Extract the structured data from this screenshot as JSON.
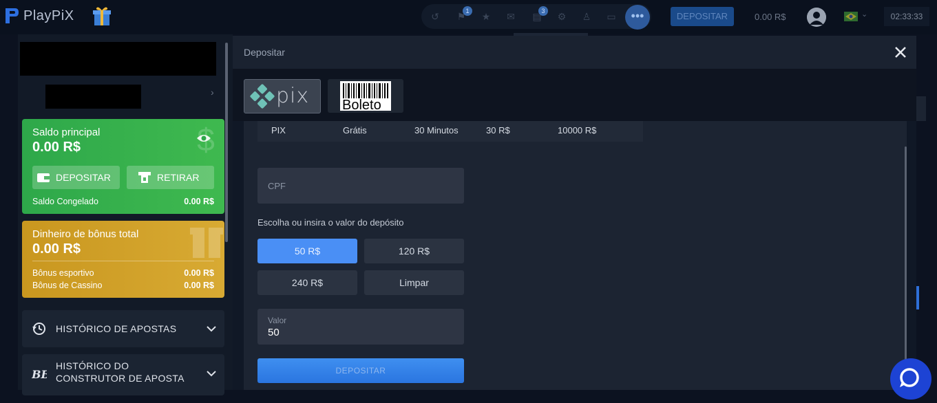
{
  "header": {
    "app_name": "PlayPiX",
    "deposit_button": "DEPOSITAR",
    "balance": "0.00 R$",
    "time": "02:33:33",
    "badge_messages": "1",
    "badge_notifications": "3",
    "more_icon": "•••"
  },
  "sidebar": {
    "main_balance": {
      "title": "Saldo principal",
      "amount": "0.00 R$",
      "deposit_label": "DEPOSITAR",
      "withdraw_label": "RETIRAR",
      "frozen_label": "Saldo Congelado",
      "frozen_value": "0.00 R$"
    },
    "bonus_balance": {
      "title": "Dinheiro de bônus total",
      "amount": "0.00 R$",
      "sport_label": "Bônus esportivo",
      "sport_value": "0.00 R$",
      "casino_label": "Bônus de Cassino",
      "casino_value": "0.00 R$"
    },
    "accordion": {
      "bet_history": "HISTÓRICO DE APOSTAS",
      "builder_history_line1": "HISTÓRICO DO",
      "builder_history_line2": "CONSTRUTOR DE APOSTA"
    }
  },
  "modal": {
    "title": "Depositar",
    "tabs": {
      "pix_label": "pix",
      "boleto_label": "Boleto"
    },
    "method_row": {
      "method": "PIX",
      "fee": "Grátis",
      "time": "30 Minutos",
      "min": "30 R$",
      "max": "10000 R$"
    },
    "cpf_placeholder": "CPF",
    "choose_label": "Escolha ou insira o valor do depósito",
    "amount_buttons": [
      "50 R$",
      "120 R$",
      "240 R$",
      "Limpar"
    ],
    "selected_amount": "50 R$",
    "valor_label": "Valor",
    "valor_value": "50",
    "submit_label": "DEPOSITAR"
  },
  "colors": {
    "accent_blue": "#4a8ff5",
    "green_card": "#3fb94f",
    "gold_card": "#d8aa33",
    "chat_button": "#1d43d4"
  },
  "icons": {
    "logo": "playpix-logo-icon",
    "gift": "gift-icon",
    "history": "history-icon",
    "sports": "football-icon",
    "favorites": "star-icon",
    "mail": "mail-icon",
    "notifications": "inbox-icon",
    "settings": "gear-icon",
    "user": "user-icon",
    "messages": "message-icon",
    "eye": "eye-icon",
    "wallet": "wallet-icon",
    "withdraw": "withdraw-icon",
    "close": "close-icon",
    "chevron": "chevron-down-icon",
    "chat": "chat-icon"
  }
}
